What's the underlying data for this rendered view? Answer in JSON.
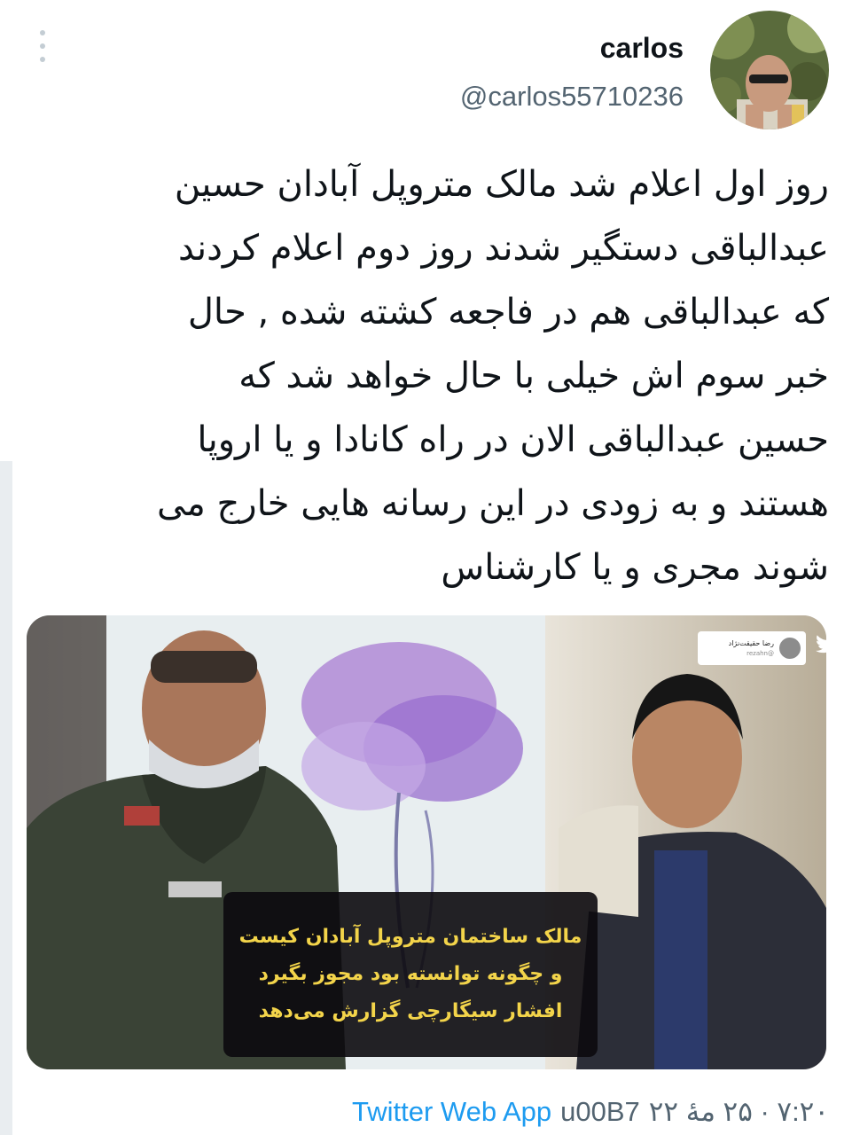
{
  "user": {
    "display_name": "carlos",
    "handle": "@carlos55710236"
  },
  "tweet": {
    "text": "روز اول اعلام شد مالک متروپل آبادان  حسین\nعبدالباقی  دستگیر شدند  روز دوم اعلام  کردند\nکه   عبدالباقی هم در فاجعه کشته شده , حال\nخبر سوم اش  خیلی با حال  خواهد شد که\nحسین عبدالباقی الان در راه کانادا و یا  اروپا\nهستند و به زودی در این رسانه هایی خارج می\nشوند  مجری  و یا کارشناس"
  },
  "media": {
    "caption_lines": [
      "مالک ساختمان متروپل آبادان کیست",
      "و چگونه توانسته بود مجوز بگیرد",
      "افشار سیگارچی گزارش می‌دهد"
    ],
    "embedded_card": {
      "name": "رضا حقیقت‌نژاد",
      "handle": "@rezahn"
    }
  },
  "meta": {
    "timestamp": "۷:۲۰ · ۲۵ مهٔ ۲۲",
    "separator": "u00B7",
    "source": "Twitter Web App"
  },
  "icons": [
    "more-options-icon",
    "twitter-bird-icon"
  ],
  "colors": {
    "link": "#1d9bf0",
    "secondary_text": "#536471",
    "caption_text": "#f3d44a"
  }
}
